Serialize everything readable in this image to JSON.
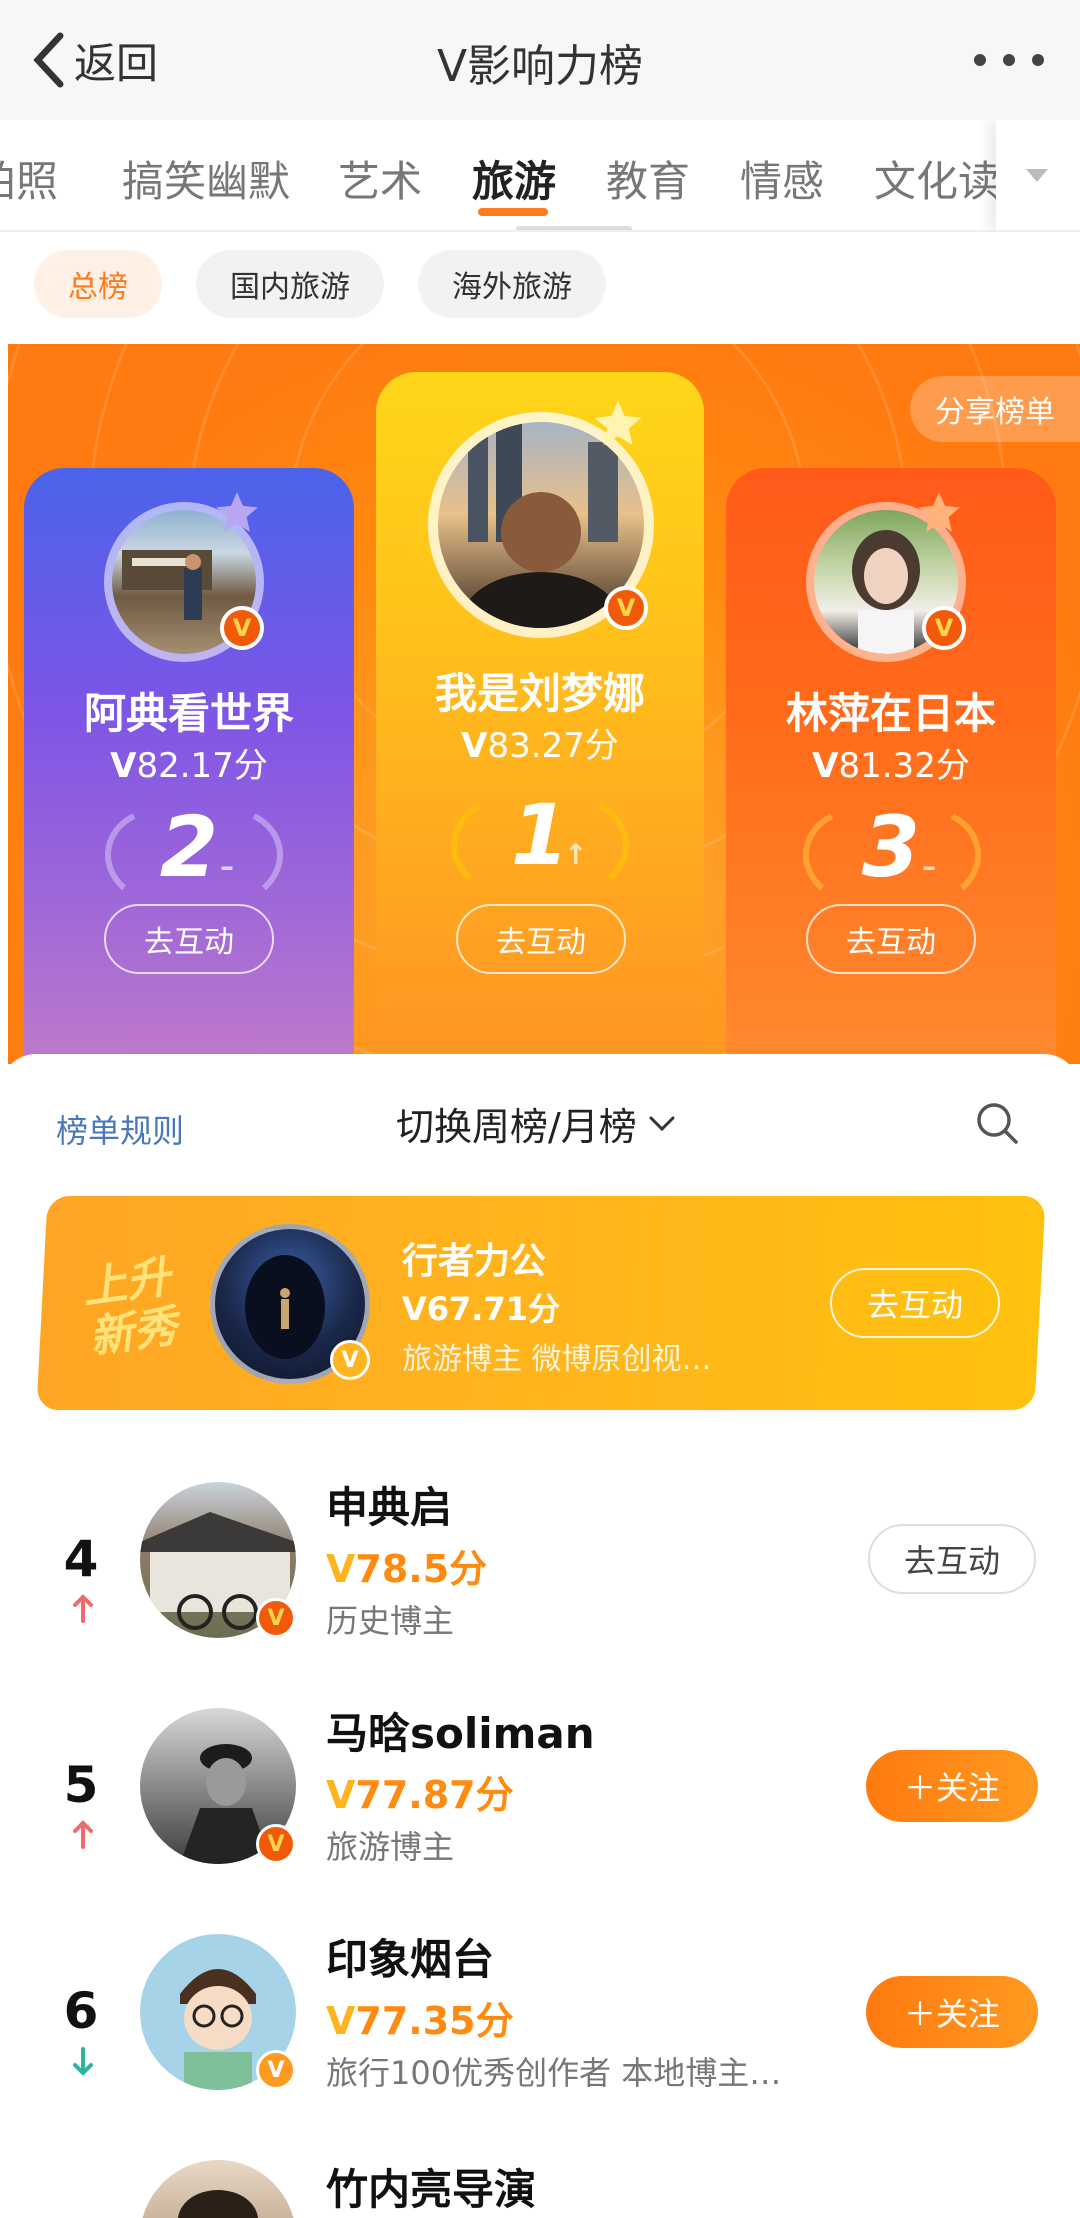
{
  "topbar": {
    "back_label": "返回",
    "title": "V影响力榜"
  },
  "categories": [
    {
      "label": "拍照"
    },
    {
      "label": "搞笑幽默"
    },
    {
      "label": "艺术"
    },
    {
      "label": "旅游",
      "active": true
    },
    {
      "label": "教育"
    },
    {
      "label": "情感"
    },
    {
      "label": "文化读"
    }
  ],
  "subtabs": [
    {
      "label": "总榜",
      "active": true
    },
    {
      "label": "国内旅游"
    },
    {
      "label": "海外旅游"
    }
  ],
  "share_label": "分享榜单",
  "podium": [
    {
      "rank": "2",
      "name": "阿典看世界",
      "score": "82.17分",
      "trend": "–",
      "button": "去互动"
    },
    {
      "rank": "1",
      "name": "我是刘梦娜",
      "score": "83.27分",
      "trend": "↑",
      "button": "去互动"
    },
    {
      "rank": "3",
      "name": "林萍在日本",
      "score": "81.32分",
      "trend": "–",
      "button": "去互动"
    }
  ],
  "controls": {
    "rules_label": "榜单规则",
    "switch_label": "切换周榜/月榜"
  },
  "rising": {
    "badge_text_1": "上升",
    "badge_text_2": "新秀",
    "name": "行者力公",
    "score": "67.71分",
    "desc": "旅游博主 微博原创视…",
    "button": "去互动"
  },
  "list": [
    {
      "rank": "4",
      "trend": "up",
      "name": "申典启",
      "score": "78.5分",
      "desc": "历史博主",
      "button": "去互动",
      "button_type": "outline"
    },
    {
      "rank": "5",
      "trend": "up",
      "name": "马晗soliman",
      "score": "77.87分",
      "desc": "旅游博主",
      "button": "＋关注",
      "button_type": "follow"
    },
    {
      "rank": "6",
      "trend": "down",
      "name": "印象烟台",
      "score": "77.35分",
      "desc": "旅行100优秀创作者 本地博主…",
      "button": "＋关注",
      "button_type": "follow"
    },
    {
      "rank": "",
      "trend": "",
      "name": "竹内亮导演",
      "score": "",
      "desc": "",
      "button": "",
      "button_type": ""
    }
  ],
  "colors": {
    "accent": "#ff7a1a",
    "link": "#4a78b8",
    "up": "#ef6b6b",
    "down": "#2bb5a0"
  }
}
